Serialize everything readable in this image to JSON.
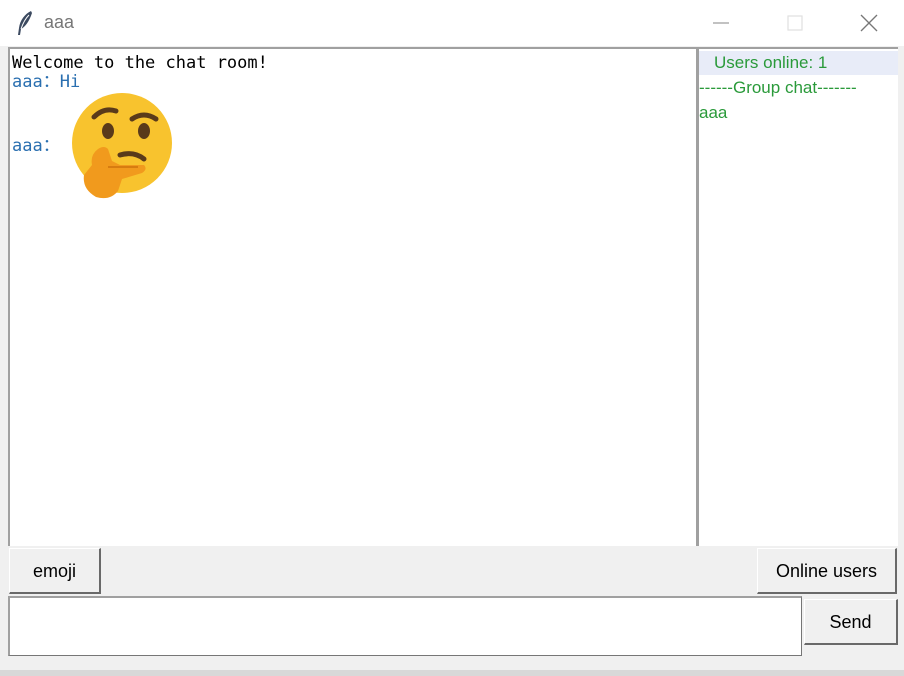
{
  "window": {
    "title": "aaa",
    "app_icon": "feather-icon",
    "controls": {
      "minimize_icon": "minimize-icon",
      "maximize_icon": "maximize-icon",
      "close_icon": "close-icon"
    }
  },
  "chat": {
    "system_message": "Welcome to the chat room!",
    "messages": [
      {
        "sender_prefix": "aaa：",
        "text": "Hi"
      },
      {
        "sender_prefix": "aaa：",
        "emoji": "thinking-face-emoji"
      }
    ],
    "message_color": "#2a6fb0"
  },
  "users_panel": {
    "header": "Users online: 1",
    "divider": "------Group chat-------",
    "users": [
      "aaa"
    ],
    "text_color": "#2a9a3a",
    "header_bg": "#e8ecf8"
  },
  "controls": {
    "emoji_button": "emoji",
    "online_users_button": "Online users",
    "send_button": "Send",
    "message_input_value": ""
  }
}
